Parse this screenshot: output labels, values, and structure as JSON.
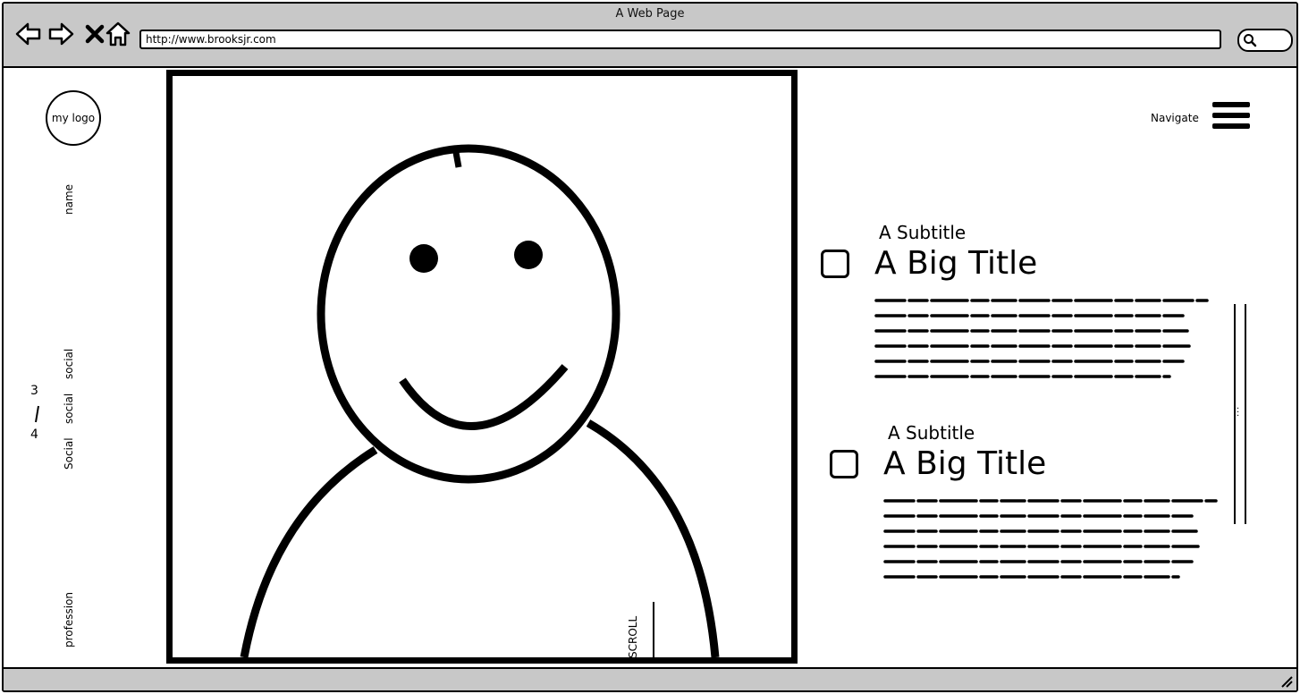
{
  "window": {
    "title": "A Web Page"
  },
  "browser": {
    "url": "http://www.brooksjr.com"
  },
  "sidebar": {
    "logo_label": "my logo",
    "name_label": "name",
    "social": [
      "social",
      "social",
      "Social"
    ],
    "pager": {
      "current": "3",
      "separator": "/",
      "total": "4"
    },
    "profession_label": "profession"
  },
  "hero": {
    "scroll_label": "SCROLL"
  },
  "header": {
    "navigate_label": "Navigate"
  },
  "articles": [
    {
      "subtitle": "A Subtitle",
      "title": "A Big Title"
    },
    {
      "subtitle": "A Subtitle",
      "title": "A Big Title"
    }
  ],
  "icons": {
    "back": "back-arrow-icon",
    "forward": "forward-arrow-icon",
    "stop": "close-icon",
    "home": "home-icon",
    "search": "search-icon",
    "menu": "hamburger-menu-icon",
    "resize": "resize-grip-icon"
  }
}
